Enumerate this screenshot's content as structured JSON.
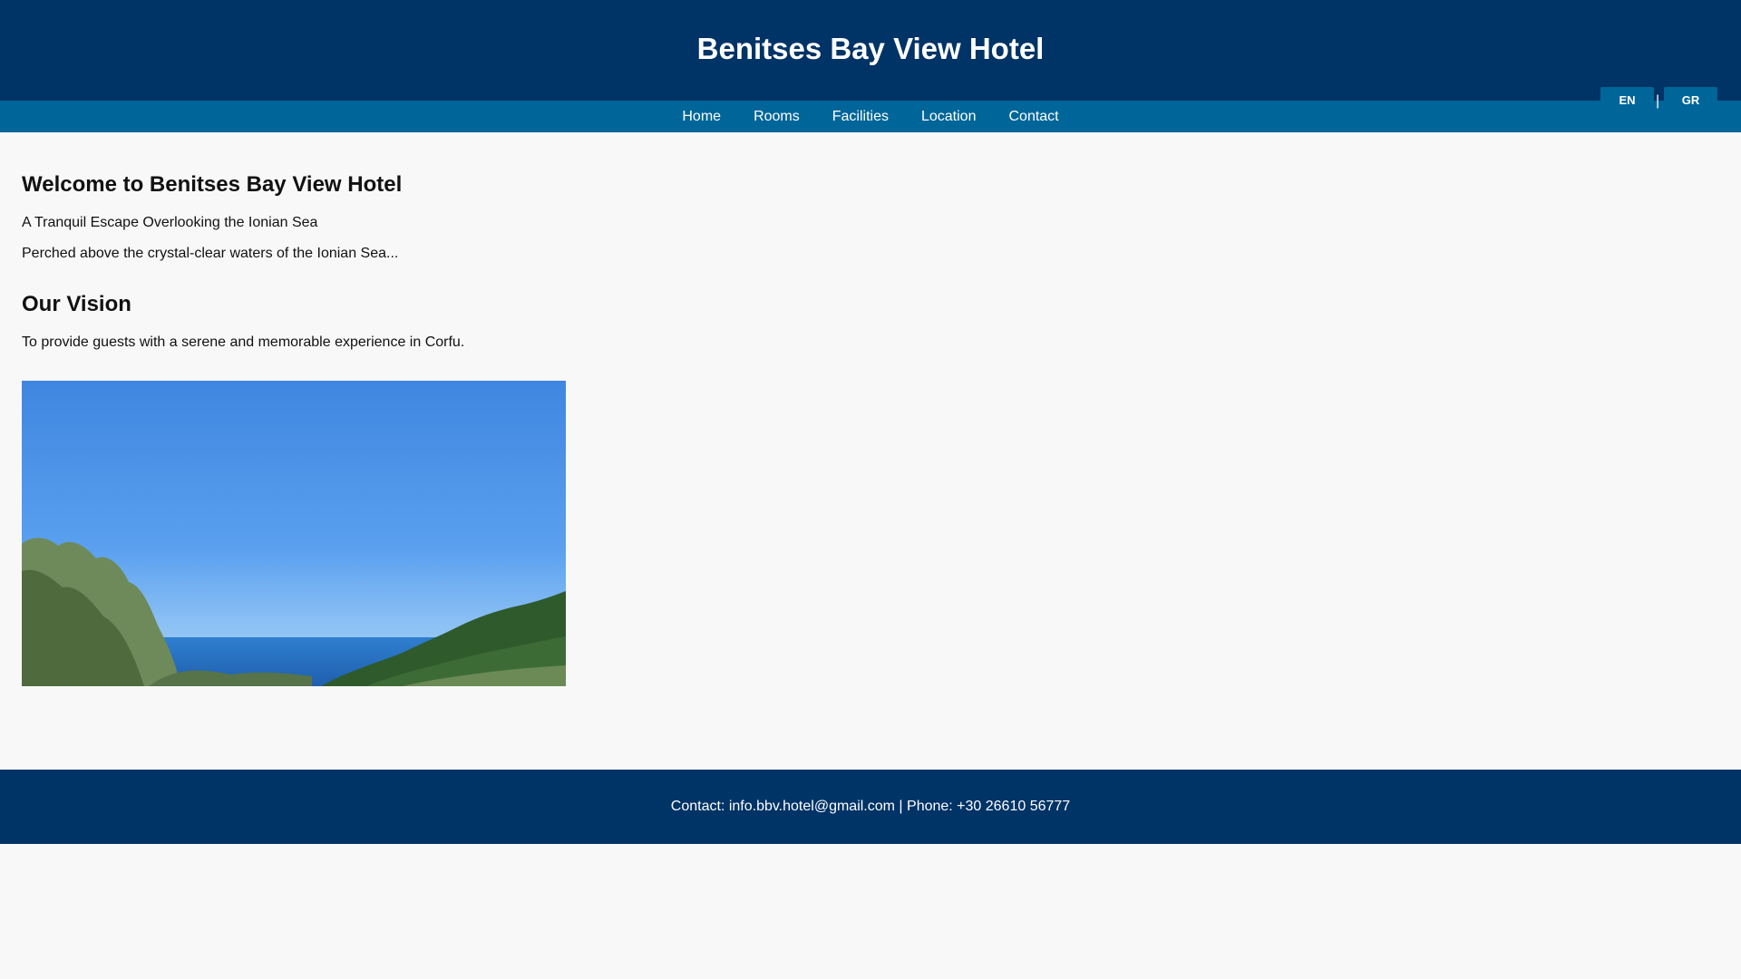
{
  "header": {
    "title": "Benitses Bay View Hotel"
  },
  "nav": {
    "items": [
      {
        "label": "Home"
      },
      {
        "label": "Rooms"
      },
      {
        "label": "Facilities"
      },
      {
        "label": "Location"
      },
      {
        "label": "Contact"
      }
    ]
  },
  "language": {
    "en": "EN",
    "separator": "|",
    "gr": "GR"
  },
  "main": {
    "welcome_title": "Welcome to Benitses Bay View Hotel",
    "tagline": "A Tranquil Escape Overlooking the Ionian Sea",
    "intro": "Perched above the crystal-clear waters of the Ionian Sea...",
    "vision_title": "Our Vision",
    "vision_text": "To provide guests with a serene and memorable experience in Corfu."
  },
  "footer": {
    "contact": "Contact: info.bbv.hotel@gmail.com | Phone: +30 26610 56777"
  },
  "colors": {
    "header_bg": "#003366",
    "nav_bg": "#006699",
    "page_bg": "#f8f8f8"
  }
}
